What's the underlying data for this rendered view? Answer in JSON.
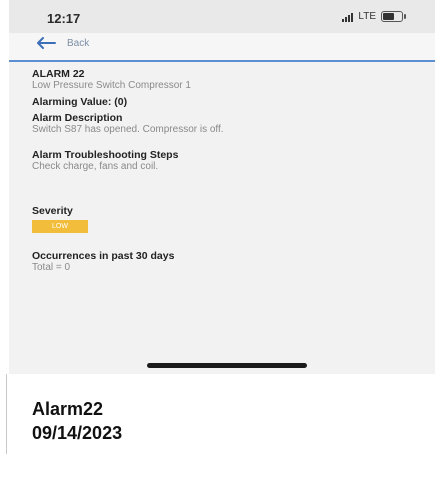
{
  "status_bar": {
    "time": "12:17",
    "network": "LTE",
    "battery_icon": "battery-icon",
    "signal_icon": "signal-icon"
  },
  "nav": {
    "back_label": "Back",
    "back_icon": "arrow-left-icon",
    "accent_color": "#5b8fd2"
  },
  "alarm": {
    "title": "ALARM 22",
    "subtitle": "Low Pressure Switch Compressor 1",
    "alarming_value_label": "Alarming Value: (0)",
    "description_heading": "Alarm Description",
    "description_text": "Switch S87 has opened. Compressor is off.",
    "troubleshooting_heading": "Alarm Troubleshooting Steps",
    "troubleshooting_text": "Check charge, fans and coil.",
    "severity_heading": "Severity",
    "severity_value": "LOW",
    "severity_color": "#f1bd3b",
    "occurrences_heading": "Occurrences in past 30 days",
    "occurrences_text": "Total = 0"
  },
  "caption": {
    "line1": "Alarm22",
    "line2": "09/14/2023"
  }
}
